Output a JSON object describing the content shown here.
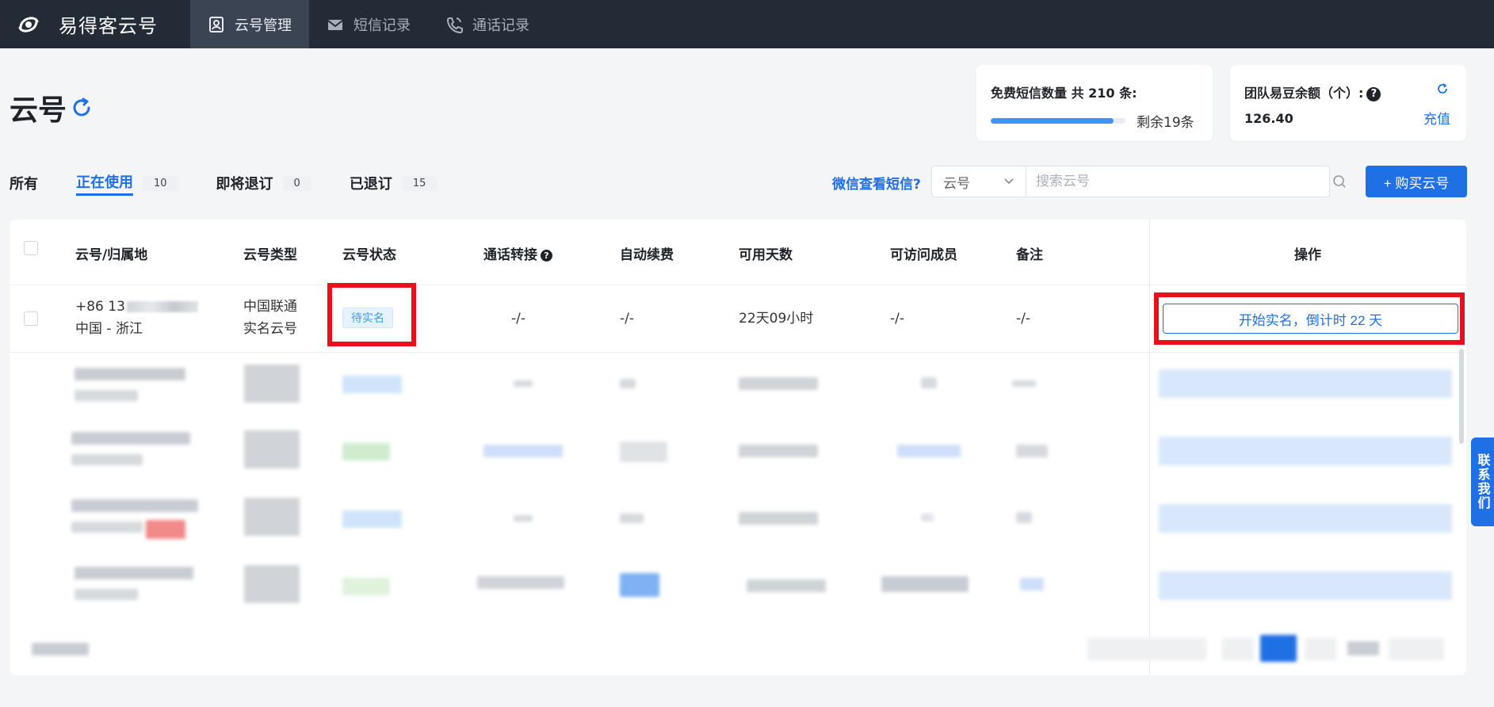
{
  "app": {
    "name": "易得客云号"
  },
  "nav": [
    {
      "label": "云号管理",
      "icon": "contact-card-icon",
      "active": true
    },
    {
      "label": "短信记录",
      "icon": "envelope-icon",
      "active": false
    },
    {
      "label": "通话记录",
      "icon": "phone-icon",
      "active": false
    }
  ],
  "page": {
    "title": "云号"
  },
  "sms_card": {
    "title": "免费短信数量 共 210 条:",
    "remaining_text": "剩余19条",
    "used_fraction": 0.91
  },
  "balance_card": {
    "title": "团队易豆余额（个）:",
    "help": "?",
    "value": "126.40",
    "recharge": "充值"
  },
  "tabs": [
    {
      "label": "所有",
      "count": null,
      "active": false
    },
    {
      "label": "正在使用",
      "count": "10",
      "active": true
    },
    {
      "label": "即将退订",
      "count": "0",
      "active": false
    },
    {
      "label": "已退订",
      "count": "15",
      "active": false
    }
  ],
  "toolbar": {
    "wechat_link": "微信查看短信?",
    "select_value": "云号",
    "search_placeholder": "搜索云号",
    "buy_button": "+ 购买云号"
  },
  "table": {
    "headers": [
      "云号/归属地",
      "云号类型",
      "云号状态",
      "通话转接",
      "自动续费",
      "可用天数",
      "可访问成员",
      "备注",
      "操作"
    ],
    "row": {
      "number": "+86 13",
      "region": "中国 - 浙江",
      "type_line1": "中国联通",
      "type_line2": "实名云号",
      "status": "待实名",
      "forward": "-/-",
      "auto_renew": "-/-",
      "days": "22天09小时",
      "members": "-/-",
      "note": "-/-",
      "action": "开始实名，倒计时 22 天"
    }
  },
  "contact": {
    "label": "联系我们"
  },
  "colors": {
    "accent": "#1f6fe5",
    "topbar": "#232b36",
    "highlight": "#e8101d"
  }
}
